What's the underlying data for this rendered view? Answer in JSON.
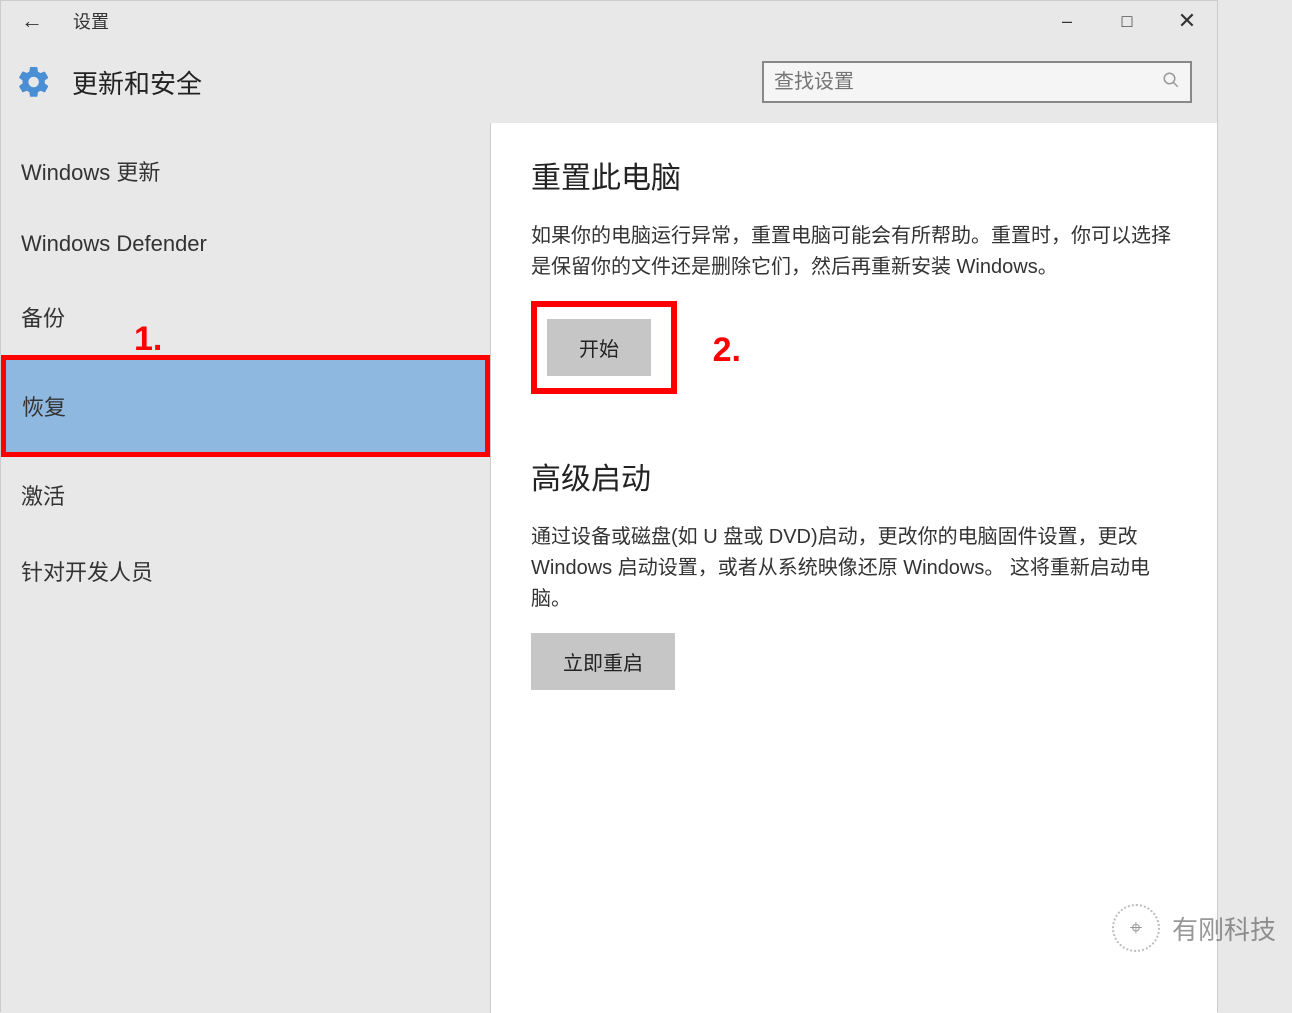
{
  "titlebar": {
    "title": "设置"
  },
  "header": {
    "title": "更新和安全",
    "search_placeholder": "查找设置"
  },
  "sidebar": {
    "items": [
      {
        "label": "Windows 更新"
      },
      {
        "label": "Windows Defender"
      },
      {
        "label": "备份"
      },
      {
        "label": "恢复"
      },
      {
        "label": "激活"
      },
      {
        "label": "针对开发人员"
      }
    ],
    "selected_index": 3
  },
  "content": {
    "reset": {
      "title": "重置此电脑",
      "desc": "如果你的电脑运行异常，重置电脑可能会有所帮助。重置时，你可以选择是保留你的文件还是删除它们，然后再重新安装 Windows。",
      "button": "开始"
    },
    "advanced": {
      "title": "高级启动",
      "desc": "通过设备或磁盘(如 U 盘或 DVD)启动，更改你的电脑固件设置，更改 Windows 启动设置，或者从系统映像还原 Windows。  这将重新启动电脑。",
      "button": "立即重启"
    }
  },
  "annotations": {
    "one": "1.",
    "two": "2."
  },
  "watermark": {
    "text": "有刚科技"
  }
}
